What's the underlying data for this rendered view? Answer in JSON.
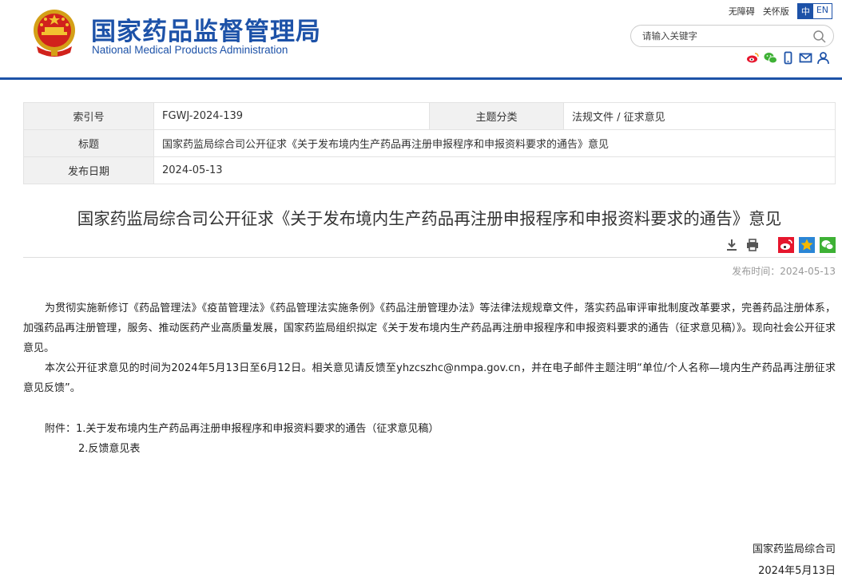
{
  "header": {
    "title_cn": "国家药品监督管理局",
    "title_en": "National Medical Products Administration",
    "accessibility_link": "无障碍",
    "elder_link": "关怀版",
    "lang_cn": "中",
    "lang_en": "EN",
    "search_placeholder": "请输入关键字",
    "social_icons": [
      "weibo-icon",
      "wechat-icon",
      "mobile-icon",
      "email-icon",
      "user-icon"
    ]
  },
  "info": {
    "index_label": "索引号",
    "index_value": "FGWJ-2024-139",
    "category_label": "主题分类",
    "category_value": "法规文件 / 征求意见",
    "title_label": "标题",
    "title_value": "国家药监局综合司公开征求《关于发布境内生产药品再注册申报程序和申报资料要求的通告》意见",
    "date_label": "发布日期",
    "date_value": "2024-05-13"
  },
  "article": {
    "title": "国家药监局综合司公开征求《关于发布境内生产药品再注册申报程序和申报资料要求的通告》意见",
    "pub_time": "发布时间：2024-05-13",
    "paragraph1": "为贯彻实施新修订《药品管理法》《疫苗管理法》《药品管理法实施条例》《药品注册管理办法》等法律法规规章文件，落实药品审评审批制度改革要求，完善药品注册体系，加强药品再注册管理，服务、推动医药产业高质量发展，国家药监局组织拟定《关于发布境内生产药品再注册申报程序和申报资料要求的通告（征求意见稿）》。现向社会公开征求意见。",
    "paragraph2": "本次公开征求意见的时间为2024年5月13日至6月12日。相关意见请反馈至yhzcszhc@nmpa.gov.cn，并在电子邮件主题注明“单位/个人名称—境内生产药品再注册征求意见反馈”。",
    "attachment1": "附件：1.关于发布境内生产药品再注册申报程序和申报资料要求的通告（征求意见稿）",
    "attachment2": "2.反馈意见表",
    "signature_org": "国家药监局综合司",
    "signature_date": "2024年5月13日"
  },
  "colors": {
    "brand_blue": "#1d52a8",
    "weibo_red": "#e6162d",
    "wechat_green": "#3eb135",
    "star_yellow": "#f5b800"
  }
}
